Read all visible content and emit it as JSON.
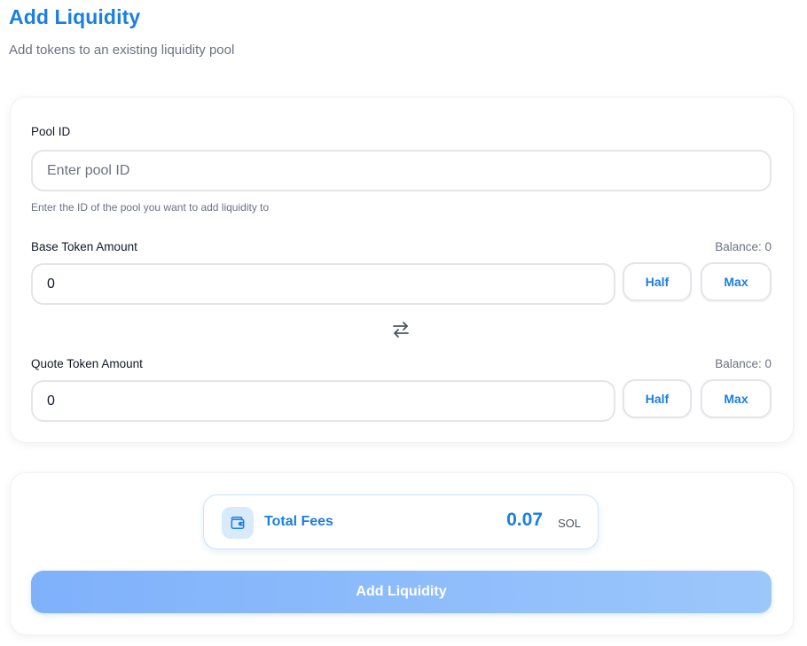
{
  "header": {
    "title": "Add Liquidity",
    "subtitle": "Add tokens to an existing liquidity pool"
  },
  "form": {
    "pool_id": {
      "label": "Pool ID",
      "value": "",
      "placeholder": "Enter pool ID",
      "hint": "Enter the ID of the pool you want to add liquidity to"
    },
    "base_token": {
      "label": "Base Token Amount",
      "balance": "Balance: 0",
      "value": "0",
      "half_label": "Half",
      "max_label": "Max"
    },
    "swap_icon": "swap-arrows-icon",
    "quote_token": {
      "label": "Quote Token Amount",
      "balance": "Balance: 0",
      "value": "0",
      "half_label": "Half",
      "max_label": "Max"
    }
  },
  "fees": {
    "icon": "wallet-icon",
    "label": "Total Fees",
    "value": "0.07",
    "unit": "SOL"
  },
  "submit": {
    "label": "Add Liquidity"
  },
  "colors": {
    "accent": "#1a7fe0",
    "button_gradient_start": "#7fb1fb",
    "button_gradient_end": "#9cc7fb",
    "fees_icon_bg": "#d8eafc",
    "muted_text": "#6b7280"
  }
}
